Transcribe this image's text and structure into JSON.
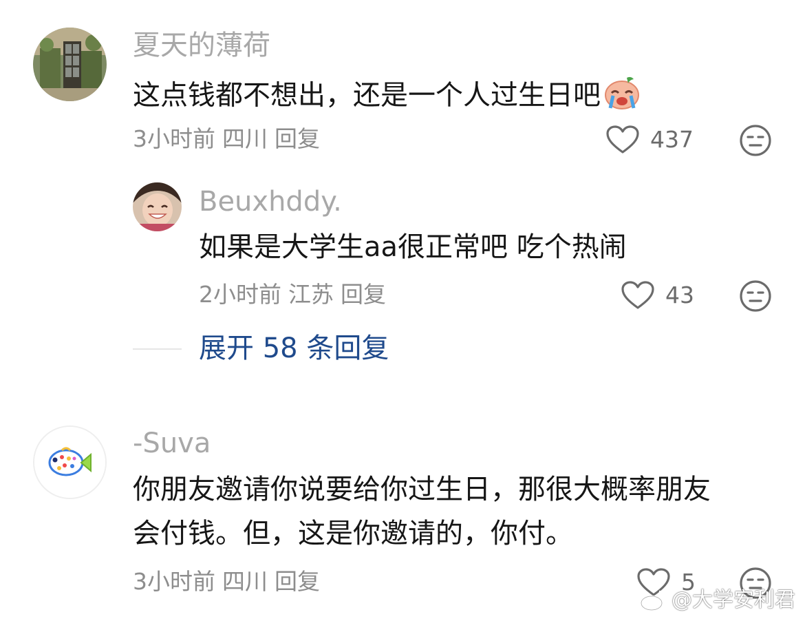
{
  "comments": [
    {
      "username": "夏天的薄荷",
      "text": "这点钱都不想出，还是一个人过生日吧",
      "emoji_icon": "crying-face-emoji",
      "time": "3小时前",
      "location": "四川",
      "reply_label": "回复",
      "likes": "437"
    },
    {
      "username": "Beuxhddy.",
      "text": "如果是大学生aa很正常吧 吃个热闹",
      "time": "2小时前",
      "location": "江苏",
      "reply_label": "回复",
      "likes": "43"
    },
    {
      "username": "-Suva",
      "text_line1": "你朋友邀请你说要给你过生日，那很大概率朋友",
      "text_line2": "会付钱。但，这是你邀请的，你付。",
      "time": "3小时前",
      "location": "四川",
      "reply_label": "回复",
      "likes": "5"
    }
  ],
  "expand_replies": "展开 58 条回复",
  "watermark": "@大学安利君",
  "colors": {
    "username": "#a8a8a8",
    "meta": "#8d8d8d",
    "link": "#1f4a8c",
    "text": "#161616"
  }
}
